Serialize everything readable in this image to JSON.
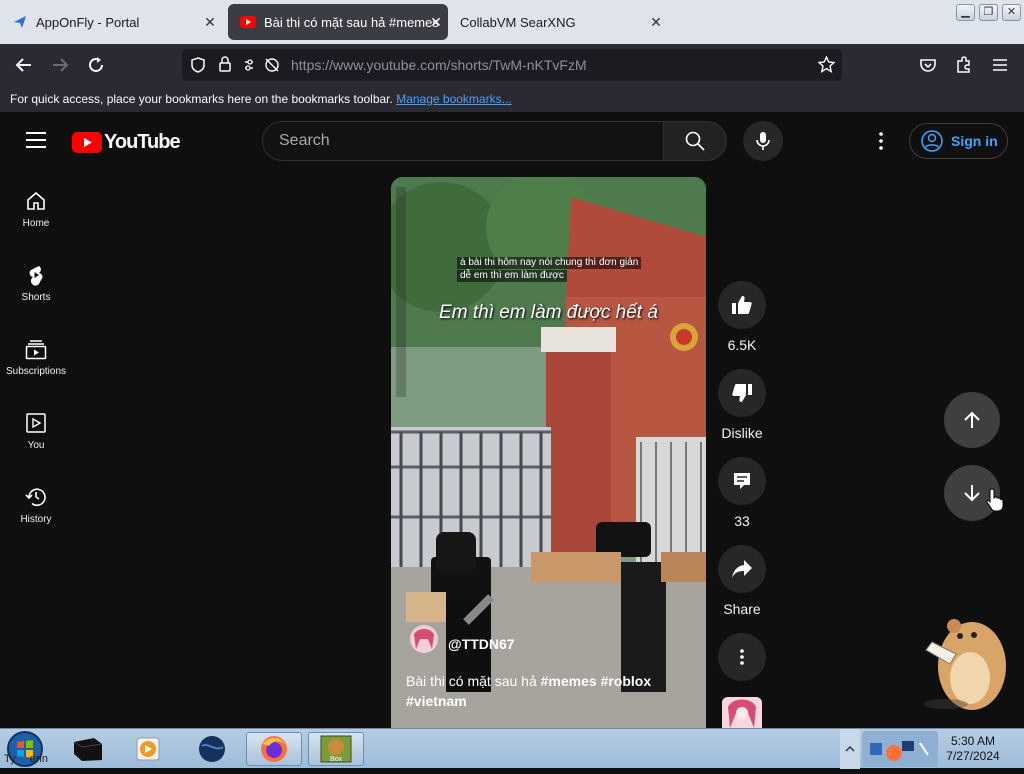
{
  "browser": {
    "tabs": [
      {
        "title": "AppOnFly - Portal",
        "active": false
      },
      {
        "title": "Bài thi có mặt sau hả #memes #roblox",
        "active": true
      },
      {
        "title": "CollabVM SearXNG",
        "active": false
      }
    ],
    "url": "https://www.youtube.com/shorts/TwM-nKTvFzM",
    "bookmarks_message": "For quick access, place your bookmarks here on the bookmarks toolbar.",
    "bookmarks_link": "Manage bookmarks..."
  },
  "youtube": {
    "logo_text": "YouTube",
    "search_placeholder": "Search",
    "signin_label": "Sign in",
    "sidebar": [
      {
        "label": "Home",
        "icon": "home-icon"
      },
      {
        "label": "Shorts",
        "icon": "shorts-icon"
      },
      {
        "label": "Subscriptions",
        "icon": "subscriptions-icon"
      },
      {
        "label": "You",
        "icon": "you-icon"
      },
      {
        "label": "History",
        "icon": "history-icon"
      }
    ],
    "short": {
      "subtitle_small_1": "à bài thi hôm nay nói chung thì đơn giản",
      "subtitle_small_2": "dễ em thì em làm được",
      "caption_big": "Em thì em làm được hết á",
      "channel": "@TTDN67",
      "title_line1": "Bài thi có mặt sau hả",
      "title_tags1": "#memes #roblox",
      "title_tags2": "#vietnam"
    },
    "actions": {
      "likes": "6.5K",
      "dislike_label": "Dislike",
      "comments": "33",
      "share_label": "Share"
    }
  },
  "taskbar": {
    "time": "5:30 AM",
    "date": "7/27/2024",
    "search_fragment": "Ty",
    "search_fragment_2": "erin"
  },
  "colors": {
    "yt_red": "#ff0000",
    "link_blue": "#3ea6ff",
    "background": "#0f0f0f"
  }
}
